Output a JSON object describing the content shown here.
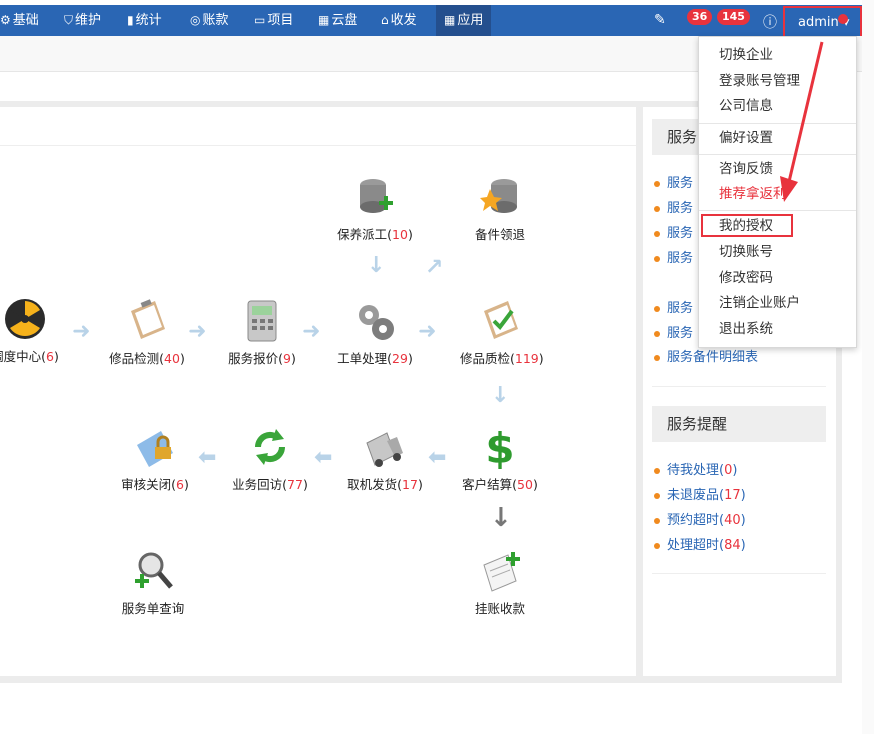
{
  "topbar": {
    "nav": [
      {
        "label": "基础",
        "icon": "gear-icon"
      },
      {
        "label": "维护",
        "icon": "shield-icon"
      },
      {
        "label": "统计",
        "icon": "bar-chart-icon"
      },
      {
        "label": "账款",
        "icon": "money-icon"
      },
      {
        "label": "项目",
        "icon": "monitor-icon"
      },
      {
        "label": "云盘",
        "icon": "grid-icon"
      },
      {
        "label": "收发",
        "icon": "inbox-icon"
      },
      {
        "label": "应用",
        "icon": "apps-icon"
      }
    ],
    "badge_messages": "36",
    "badge_tasks": "145",
    "user": "admin",
    "colors": {
      "bar": "#2a66b4",
      "active": "#244f8e",
      "badge": "#e8333d"
    }
  },
  "dropdown": {
    "items": [
      {
        "label": "切换企业"
      },
      {
        "label": "登录账号管理"
      },
      {
        "label": "公司信息"
      },
      {
        "label": "偏好设置"
      },
      {
        "label": "咨询反馈"
      },
      {
        "label": "推荐拿返利"
      },
      {
        "label": "我的授权"
      },
      {
        "label": "切换账号"
      },
      {
        "label": "修改密码"
      },
      {
        "label": "注销企业账户"
      },
      {
        "label": "退出系统"
      }
    ]
  },
  "flow": {
    "nodes": [
      {
        "label": "保养派工",
        "count": "10",
        "icon": "database-add-icon"
      },
      {
        "label": "备件领退",
        "icon": "database-star-icon"
      },
      {
        "label": "调度中心",
        "count": "6",
        "icon": "radiation-icon"
      },
      {
        "label": "修品检测",
        "count": "40",
        "icon": "clipboard-icon"
      },
      {
        "label": "服务报价",
        "count": "9",
        "icon": "calculator-icon"
      },
      {
        "label": "工单处理",
        "count": "29",
        "icon": "gears-icon"
      },
      {
        "label": "修品质检",
        "count": "119",
        "icon": "clipboard-check-icon"
      },
      {
        "label": "审核关闭",
        "count": "6",
        "icon": "lock-card-icon"
      },
      {
        "label": "业务回访",
        "count": "77",
        "icon": "refresh-icon"
      },
      {
        "label": "取机发货",
        "count": "17",
        "icon": "truck-icon"
      },
      {
        "label": "客户结算",
        "count": "50",
        "icon": "dollar-icon"
      },
      {
        "label": "服务单查询",
        "icon": "magnifier-add-icon"
      },
      {
        "label": "挂账收款",
        "icon": "scroll-add-icon"
      }
    ]
  },
  "right_panel": {
    "section1_title": "服务",
    "section1_items": [
      "服务",
      "服务",
      "服务",
      "服务",
      "服务",
      "服务",
      "服务备件明细表"
    ],
    "section2_title": "服务提醒",
    "section2_items": [
      {
        "label": "待我处理",
        "count": "0"
      },
      {
        "label": "未退废品",
        "count": "17"
      },
      {
        "label": "预约超时",
        "count": "40"
      },
      {
        "label": "处理超时",
        "count": "84"
      }
    ]
  }
}
